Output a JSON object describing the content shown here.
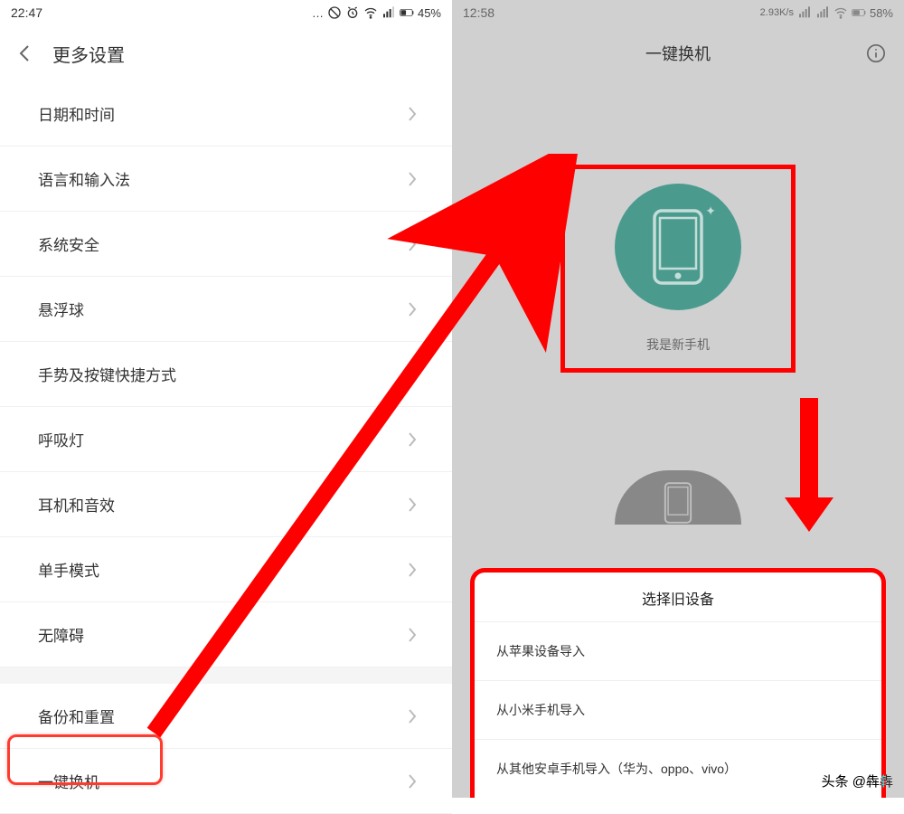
{
  "left": {
    "status": {
      "time": "22:47",
      "battery": "45%"
    },
    "header": {
      "title": "更多设置"
    },
    "items": [
      "日期和时间",
      "语言和输入法",
      "系统安全",
      "悬浮球",
      "手势及按键快捷方式",
      "呼吸灯",
      "耳机和音效",
      "单手模式",
      "无障碍",
      "备份和重置",
      "一键换机"
    ]
  },
  "right": {
    "status": {
      "time": "12:58",
      "net": "2.93K/s",
      "battery": "58%"
    },
    "header": {
      "title": "一键换机"
    },
    "new_phone_label": "我是新手机",
    "dialog": {
      "title": "选择旧设备",
      "items": [
        "从苹果设备导入",
        "从小米手机导入",
        "从其他安卓手机导入（华为、oppo、vivo）"
      ]
    }
  },
  "watermark": "头条 @犇犇"
}
